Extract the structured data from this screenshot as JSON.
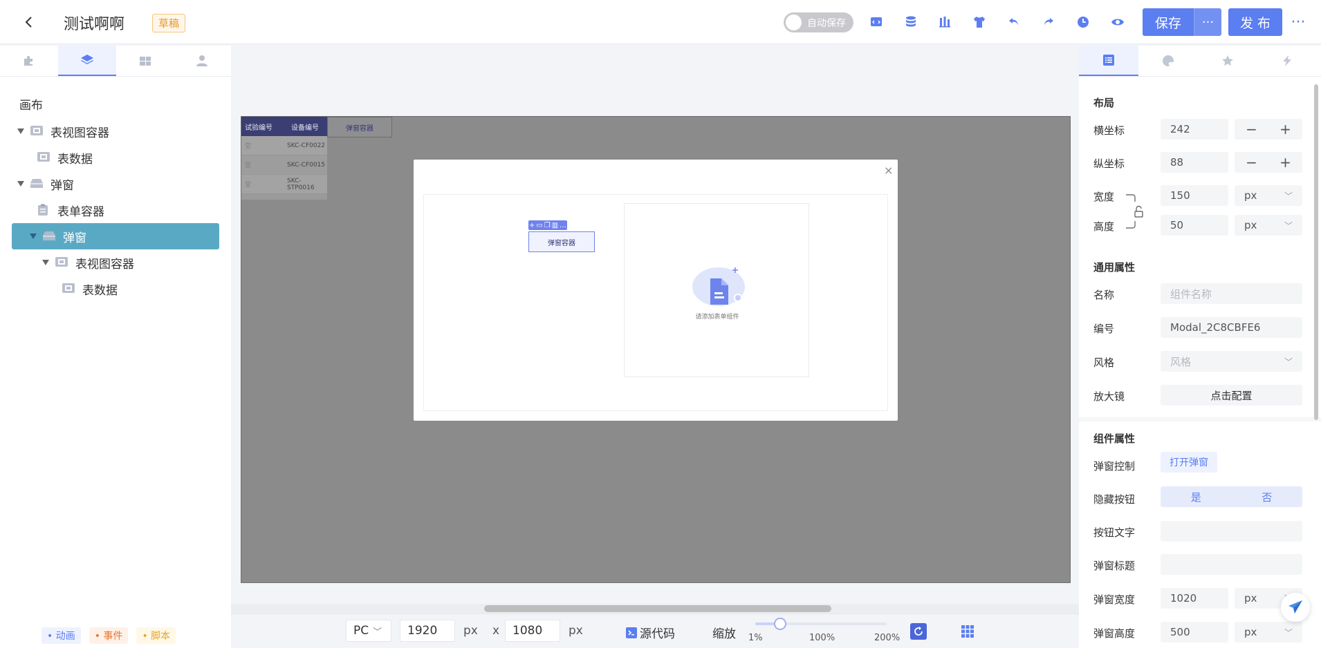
{
  "header": {
    "title": "测试啊啊",
    "status_badge": "草稿",
    "autosave_label": "自动保存",
    "save_label": "保存",
    "publish_label": "发 布",
    "icons": [
      "code-template-icon",
      "database-icon",
      "chart-icon",
      "theme-shirt-icon",
      "undo-icon",
      "redo-icon",
      "history-clock-icon",
      "preview-eye-icon"
    ]
  },
  "left_panel": {
    "tabs": [
      "puzzle-icon",
      "layers-icon",
      "group-icon",
      "user-icon"
    ],
    "active_tab": 1,
    "canvas_label": "画布",
    "tree": [
      {
        "label": "表视图容器",
        "level": 0,
        "expanded": true,
        "selected": false,
        "icon": "view-container-icon"
      },
      {
        "label": "表数据",
        "level": 1,
        "expanded": null,
        "selected": false,
        "icon": "table-data-icon"
      },
      {
        "label": "弹窗",
        "level": 0,
        "expanded": true,
        "selected": false,
        "icon": "modal-icon"
      },
      {
        "label": "表单容器",
        "level": 1,
        "expanded": null,
        "selected": false,
        "icon": "form-container-icon"
      },
      {
        "label": "弹窗",
        "level": 1,
        "expanded": true,
        "selected": true,
        "icon": "modal-icon"
      },
      {
        "label": "表视图容器",
        "level": 2,
        "expanded": true,
        "selected": false,
        "icon": "view-container-icon"
      },
      {
        "label": "表数据",
        "level": 3,
        "expanded": null,
        "selected": false,
        "icon": "table-data-icon"
      }
    ],
    "bottom_tags": [
      {
        "label": "• 动画",
        "color": "#5b7ef0",
        "bg": "#eef2fe"
      },
      {
        "label": "• 事件",
        "color": "#e8762c",
        "bg": "#fff1e8"
      },
      {
        "label": "• 脚本",
        "color": "#e5a72d",
        "bg": "#fff8e6"
      }
    ]
  },
  "canvas": {
    "table_headers": [
      "试验编号",
      "设备编号"
    ],
    "table_rows": [
      [
        "空",
        "SKC-CF0022"
      ],
      [
        "空",
        "SKC-CF0015"
      ],
      [
        "空",
        "SKC-STP0016"
      ]
    ],
    "modal_container_button": "弹窗容器",
    "modal_close": "×",
    "selected_component_label": "弹窗容器",
    "empty_state_text": "请添加表单组件"
  },
  "bottom_toolbar": {
    "device": "PC",
    "width": "1920",
    "height": "1080",
    "unit": "px",
    "times": "x",
    "source_code_label": "源代码",
    "zoom_label": "缩放",
    "zoom_min": "1%",
    "zoom_mid": "100%",
    "zoom_max": "200%",
    "zoom_value_fraction": 0.19
  },
  "right_panel": {
    "tabs": [
      "property-list-icon",
      "style-palette-icon",
      "star-icon",
      "event-bolt-icon"
    ],
    "active_tab": 0,
    "layout_title": "布局",
    "x_label": "横坐标",
    "x_value": "242",
    "y_label": "纵坐标",
    "y_value": "88",
    "width_label": "宽度",
    "width_value": "150",
    "height_label": "高度",
    "height_value": "50",
    "unit": "px",
    "general_title": "通用属性",
    "name_label": "名称",
    "name_placeholder": "组件名称",
    "id_label": "编号",
    "id_value": "Modal_2C8CBFE6",
    "style_label": "风格",
    "style_placeholder": "风格",
    "magnifier_label": "放大镜",
    "magnifier_button": "点击配置",
    "component_title": "组件属性",
    "modal_control_label": "弹窗控制",
    "modal_control_button": "打开弹窗",
    "hide_button_label": "隐藏按钮",
    "hide_yes": "是",
    "hide_no": "否",
    "button_text_label": "按钮文字",
    "modal_title_label": "弹窗标题",
    "modal_width_label": "弹窗宽度",
    "modal_width_value": "1020",
    "modal_height_label": "弹窗高度",
    "modal_height_value": "500"
  },
  "colors": {
    "primary": "#5b7ef0",
    "selected_tree": "#5aa9c4",
    "draft": "#e59a2d"
  }
}
